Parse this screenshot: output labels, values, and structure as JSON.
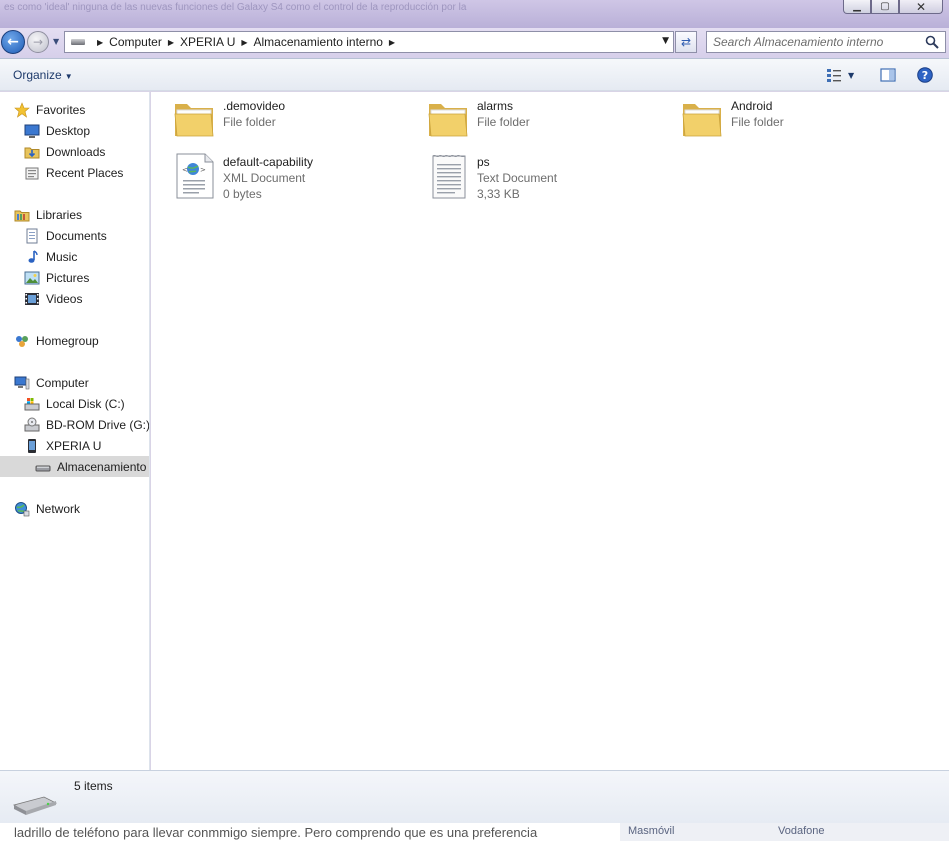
{
  "window": {
    "background_text": "es como 'ideal' ninguna de las nuevas funciones del Galaxy S4 como el control de la reproducción por la",
    "minimize": "▁",
    "maximize": "▢",
    "close": "✕"
  },
  "address": {
    "crumbs": [
      "Computer",
      "XPERIA U",
      "Almacenamiento interno"
    ],
    "search_placeholder": "Search Almacenamiento interno"
  },
  "toolbar": {
    "organize_label": "Organize"
  },
  "sidebar": {
    "favorites": "Favorites",
    "desktop": "Desktop",
    "downloads": "Downloads",
    "recent": "Recent Places",
    "libraries": "Libraries",
    "documents": "Documents",
    "music": "Music",
    "pictures": "Pictures",
    "videos": "Videos",
    "homegroup": "Homegroup",
    "computer": "Computer",
    "local_disk": "Local Disk (C:)",
    "bd_rom": "BD-ROM Drive (G:) ...",
    "xperia": "XPERIA U",
    "almacenamiento": "Almacenamiento",
    "network": "Network"
  },
  "files": [
    {
      "name": ".demovideo",
      "type": "File folder",
      "icon": "folder-icon"
    },
    {
      "name": "alarms",
      "type": "File folder",
      "icon": "folder-icon"
    },
    {
      "name": "Android",
      "type": "File folder",
      "icon": "folder-icon"
    },
    {
      "name": "default-capability",
      "type": "XML Document",
      "size": "0 bytes",
      "icon": "xml-document-icon"
    },
    {
      "name": "ps",
      "type": "Text Document",
      "size": "3,33 KB",
      "icon": "text-document-icon"
    }
  ],
  "status": {
    "item_count": "5 items"
  },
  "background_page": {
    "text": "ladrillo de teléfono para llevar conmmigo siempre. Pero comprendo que es una preferencia",
    "sidebar_left": "Masmóvil",
    "sidebar_right": "Vodafone"
  }
}
